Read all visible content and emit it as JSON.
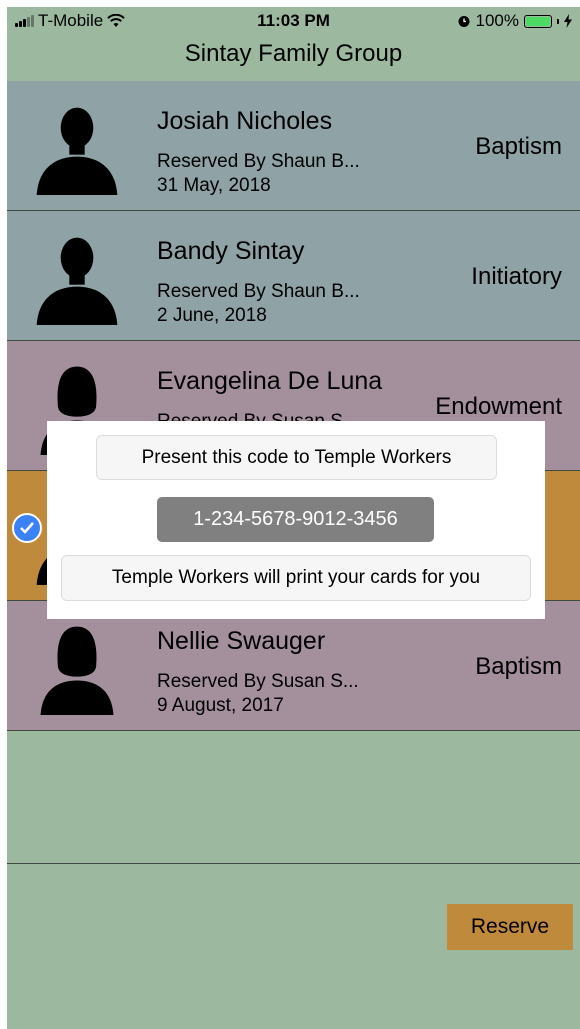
{
  "status_bar": {
    "carrier": "T-Mobile",
    "time": "11:03 PM",
    "battery": "100%"
  },
  "header": {
    "title": "Sintay Family Group"
  },
  "rows": [
    {
      "name": "Josiah Nicholes",
      "reserved": "Reserved By Shaun B...",
      "date": "31 May, 2018",
      "ordinance": "Baptism",
      "avatar": "male-silhouette-icon",
      "color": "#8fa2a6"
    },
    {
      "name": "Bandy Sintay",
      "reserved": "Reserved By Shaun B...",
      "date": "2 June, 2018",
      "ordinance": "Initiatory",
      "avatar": "male-silhouette-icon",
      "color": "#8fa2a6"
    },
    {
      "name": "Evangelina De Luna",
      "reserved": "Reserved By Susan S...",
      "date": "",
      "ordinance": "Endowment",
      "avatar": "female-silhouette-icon",
      "color": "#a48f9d"
    },
    {
      "name": "",
      "reserved": "",
      "date": "",
      "ordinance": "",
      "avatar": "male-silhouette-icon",
      "color": "#c08a3c",
      "selected": true
    },
    {
      "name": "Nellie Swauger",
      "reserved": "Reserved By Susan S...",
      "date": "9 August, 2017",
      "ordinance": "Baptism",
      "avatar": "female-silhouette-icon",
      "color": "#a48f9d"
    }
  ],
  "modal": {
    "title": "Present this code to Temple Workers",
    "code": "1-234-5678-9012-3456",
    "note": "Temple Workers will print your cards for you"
  },
  "footer": {
    "reserve_label": "Reserve"
  },
  "colors": {
    "background": "#9cb9a0",
    "accent": "#c08a3c",
    "male_row": "#8fa2a6",
    "female_row": "#a48f9d",
    "check": "#3b82f6"
  }
}
